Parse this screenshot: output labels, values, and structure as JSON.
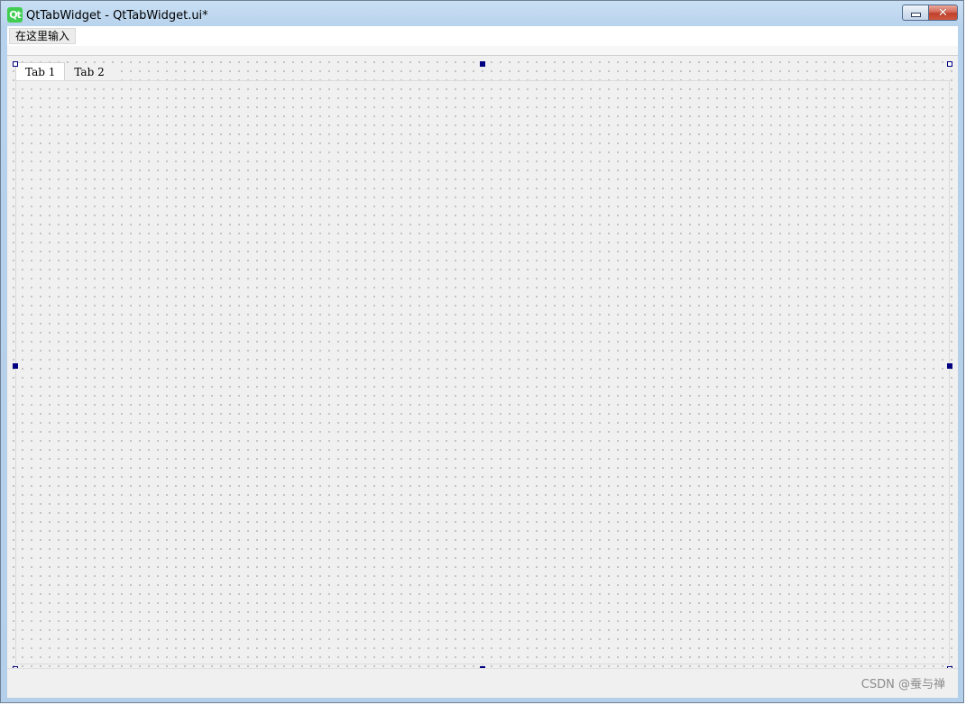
{
  "window": {
    "title": "QtTabWidget - QtTabWidget.ui*",
    "app_icon_text": "Qt"
  },
  "menubar": {
    "placeholder_item": "在这里输入"
  },
  "tabs": [
    {
      "label": "Tab 1",
      "active": true
    },
    {
      "label": "Tab 2",
      "active": false
    }
  ],
  "watermark": "CSDN @蚕与禅",
  "colors": {
    "qt_green": "#41cd52",
    "selection_handle": "#000080",
    "close_button": "#c0402c"
  },
  "icons": {
    "minimize": "minimize-icon",
    "close": "close-icon",
    "app": "qt-logo-icon"
  }
}
